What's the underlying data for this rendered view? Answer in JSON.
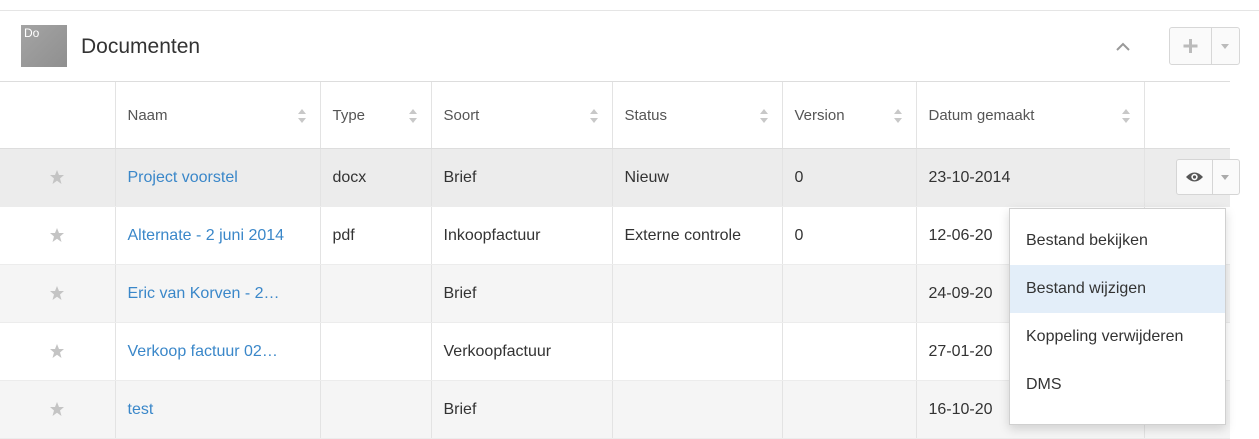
{
  "panel": {
    "badge_text": "Do",
    "title": "Documenten",
    "collapse_icon": "chevron-up-icon",
    "add_icon": "plus-icon",
    "menu_icon": "caret-down-icon"
  },
  "table": {
    "columns": [
      "",
      "Naam",
      "Type",
      "Soort",
      "Status",
      "Version",
      "Datum gemaakt",
      ""
    ],
    "rows": [
      {
        "name": "Project voorstel",
        "type": "docx",
        "soort": "Brief",
        "status": "Nieuw",
        "version": "0",
        "date": "23-10-2014"
      },
      {
        "name": "Alternate - 2 juni 2014",
        "type": "pdf",
        "soort": "Inkoopfactuur",
        "status": "Externe controle",
        "version": "0",
        "date": "12-06-20"
      },
      {
        "name": "Eric van Korven - 2…",
        "type": "",
        "soort": "Brief",
        "status": "",
        "version": "",
        "date": "24-09-20"
      },
      {
        "name": "Verkoop factuur 02…",
        "type": "",
        "soort": "Verkoopfactuur",
        "status": "",
        "version": "",
        "date": "27-01-20"
      },
      {
        "name": "test",
        "type": "",
        "soort": "Brief",
        "status": "",
        "version": "",
        "date": "16-10-20"
      }
    ]
  },
  "row_actions": {
    "view_icon": "eye-icon",
    "caret_icon": "caret-down-icon"
  },
  "dropdown": {
    "items": [
      "Bestand bekijken",
      "Bestand wijzigen",
      "Koppeling verwijderen",
      "DMS"
    ],
    "highlighted": "Bestand wijzigen"
  },
  "colors": {
    "link": "#3a87c9",
    "highlight": "#e3eef9",
    "badge": "#9a9a9a"
  }
}
